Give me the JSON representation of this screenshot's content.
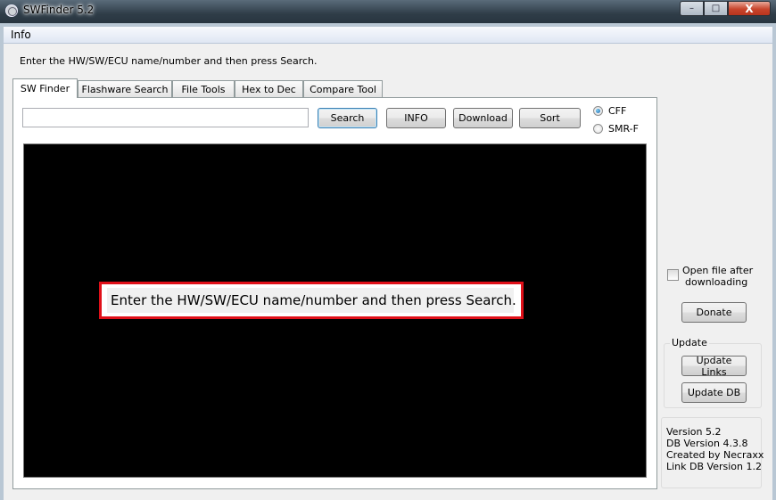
{
  "window": {
    "title": "SWFinder 5.2",
    "controls": {
      "minimize": "–",
      "maximize": "□",
      "close": "X"
    },
    "icon": "mercedes-star-icon"
  },
  "menu": {
    "items": [
      {
        "label": "Info"
      }
    ]
  },
  "instruction": "Enter the HW/SW/ECU name/number and then press Search.",
  "tabs": [
    {
      "label": "SW Finder",
      "active": true
    },
    {
      "label": "Flashware Search"
    },
    {
      "label": "File Tools"
    },
    {
      "label": "Hex to Dec"
    },
    {
      "label": "Compare Tool"
    }
  ],
  "search": {
    "value": "",
    "placeholder": ""
  },
  "buttons": {
    "search": "Search",
    "info": "INFO",
    "download": "Download",
    "sort": "Sort",
    "donate": "Donate",
    "update_links": "Update Links",
    "update_db": "Update DB"
  },
  "format_options": [
    {
      "label": "CFF",
      "checked": true
    },
    {
      "label": "SMR-F",
      "checked": false
    }
  ],
  "output": {
    "background": "#000000",
    "callout_text": "Enter the HW/SW/ECU name/number and then press Search.",
    "callout_border_color": "#e01019"
  },
  "open_file_option": {
    "label_line1": "Open file after",
    "label_line2": "downloading",
    "checked": false
  },
  "update_group": {
    "title": "Update"
  },
  "version_info": {
    "version": "Version 5.2",
    "db_version": "DB Version 4.3.8",
    "created_by": "Created by Necraxx",
    "link_db_version": "Link DB Version 1.2"
  }
}
